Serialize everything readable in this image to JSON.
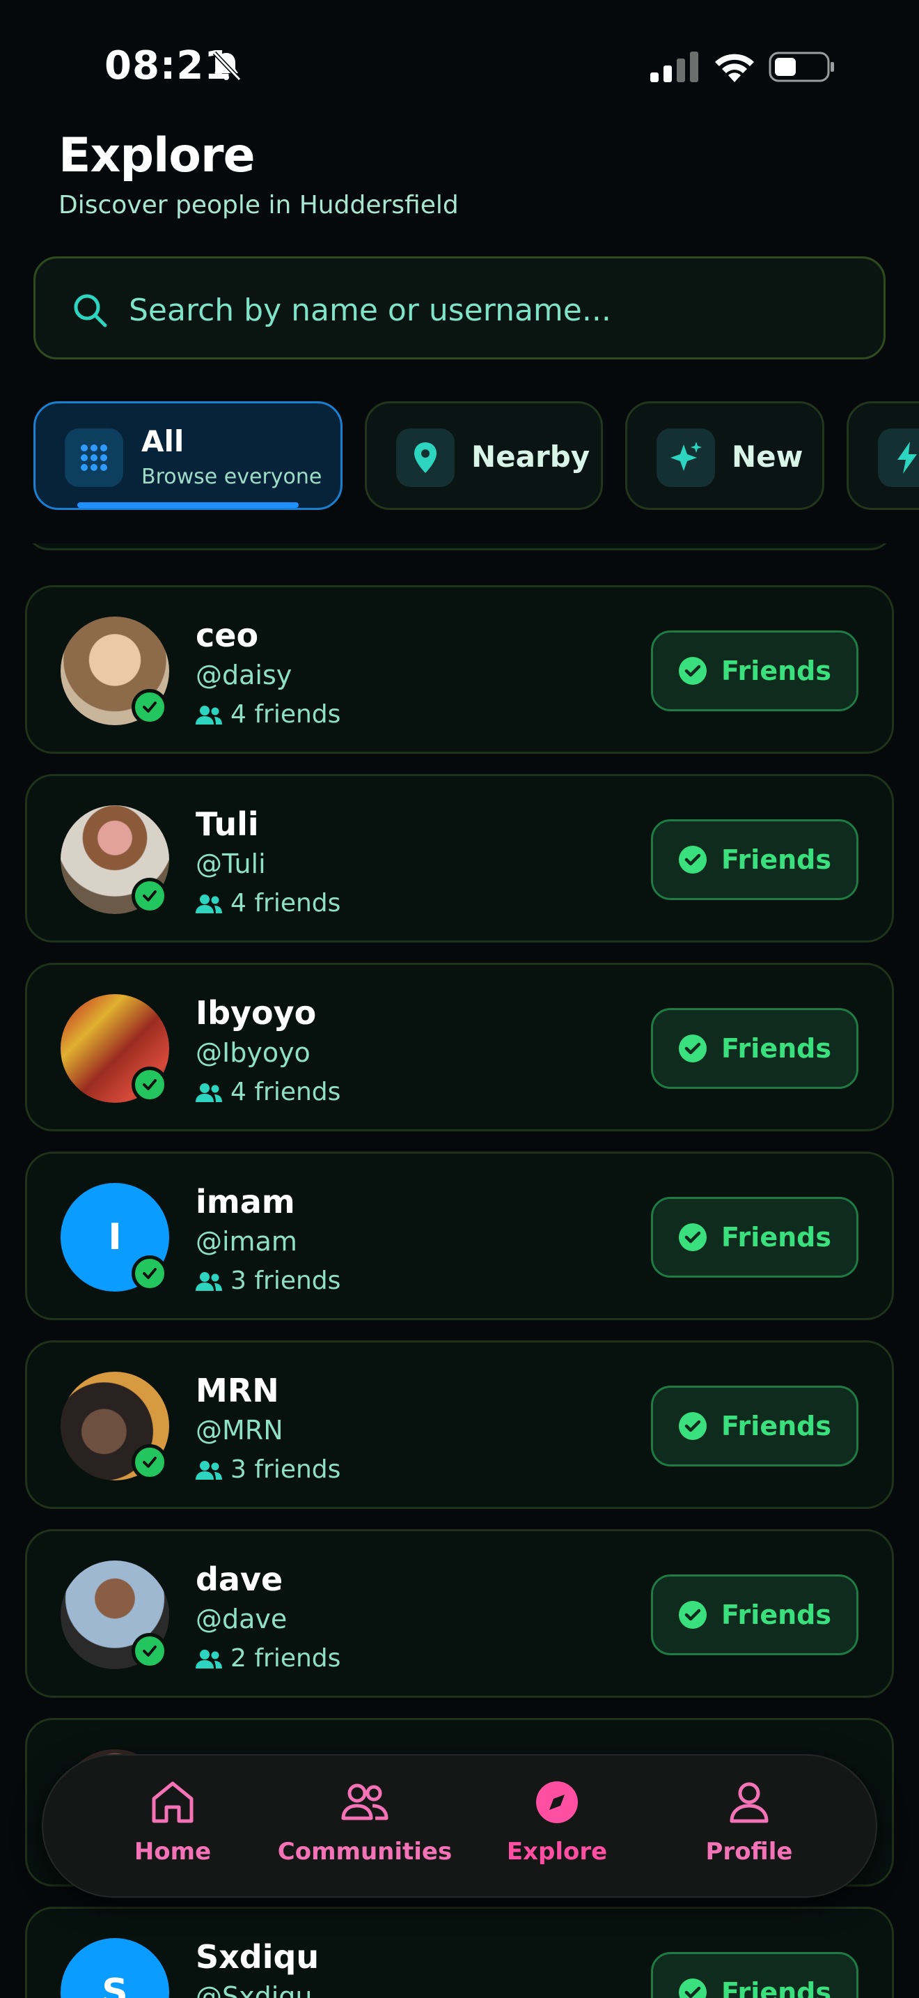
{
  "status_bar": {
    "time": "08:21"
  },
  "header": {
    "title": "Explore",
    "subtitle": "Discover people in Huddersfield"
  },
  "search": {
    "placeholder": "Search by name or username..."
  },
  "filters": [
    {
      "label": "All",
      "sub": "Browse everyone",
      "icon": "grid-icon",
      "active": true
    },
    {
      "label": "Nearby",
      "icon": "map-pin-icon",
      "active": false
    },
    {
      "label": "New",
      "icon": "sparkles-icon",
      "active": false
    },
    {
      "label": "",
      "icon": "bolt-icon",
      "active": false
    }
  ],
  "users": [
    {
      "name": "ceo",
      "handle": "@daisy",
      "friends": "4 friends",
      "button": "Friends"
    },
    {
      "name": "Tuli",
      "handle": "@Tuli",
      "friends": "4 friends",
      "button": "Friends"
    },
    {
      "name": "Ibyoyo",
      "handle": "@Ibyoyo",
      "friends": "4 friends",
      "button": "Friends"
    },
    {
      "name": "imam",
      "handle": "@imam",
      "friends": "3 friends",
      "button": "Friends",
      "initial": "I"
    },
    {
      "name": "MRN",
      "handle": "@MRN",
      "friends": "3 friends",
      "button": "Friends"
    },
    {
      "name": "dave",
      "handle": "@dave",
      "friends": "2 friends",
      "button": "Friends"
    },
    {
      "name": "",
      "handle": "",
      "friends": "",
      "button": ""
    },
    {
      "name": "Sxdiqu",
      "handle": "@Sxdiqu",
      "friends": "",
      "button": "Friends",
      "initial": "S"
    }
  ],
  "bottom_nav": [
    {
      "label": "Home",
      "icon": "home-icon"
    },
    {
      "label": "Communities",
      "icon": "users-icon"
    },
    {
      "label": "Explore",
      "icon": "compass-icon",
      "active": true
    },
    {
      "label": "Profile",
      "icon": "user-icon"
    }
  ],
  "colors": {
    "background": "#05090b",
    "accent_green": "#39e07d",
    "accent_pink": "#ff4fa3",
    "accent_blue": "#1e90ff",
    "text_teal": "#8fe0c4"
  }
}
